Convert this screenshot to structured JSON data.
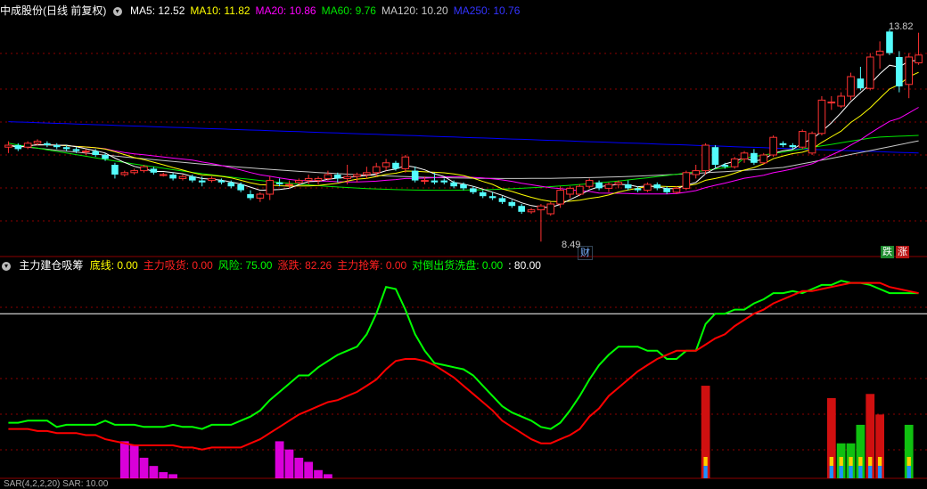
{
  "colors": {
    "up": "#ff3232",
    "down": "#54fcfc",
    "ma5": "#ffffff",
    "ma10": "#ffff00",
    "ma20": "#ff00ff",
    "ma60": "#00e600",
    "ma120": "#c8c8c8",
    "ma250": "#0000ff",
    "grid": "#8b0000",
    "risk": "#00ff00",
    "zhangdie": "#ff0000",
    "pink": "#ff00ff",
    "white_line": "#ffffff"
  },
  "price_panel": {
    "stock_title": "中成股份(日线 前复权)",
    "ma_legend": [
      {
        "label": "MA5: 12.52",
        "color": "#ffffff"
      },
      {
        "label": "MA10: 11.82",
        "color": "#ffff00"
      },
      {
        "label": "MA20: 10.86",
        "color": "#ff00ff"
      },
      {
        "label": "MA60: 9.76",
        "color": "#00e600"
      },
      {
        "label": "MA120: 10.20",
        "color": "#c8c8c8"
      },
      {
        "label": "MA250: 10.76",
        "color": "#3333ff"
      }
    ],
    "high_label": "13.82",
    "low_label": "8.49",
    "badge_cai": "财",
    "badge_die": "跌",
    "badge_zhang": "涨"
  },
  "indicator_panel": {
    "title": "主力建仓吸筹",
    "items": [
      {
        "label": "底线: 0.00",
        "color": "#ffff00"
      },
      {
        "label": "主力吸货: 0.00",
        "color": "#ff2020"
      },
      {
        "label": "风险: 75.00",
        "color": "#00ff00"
      },
      {
        "label": "涨跌: 82.26",
        "color": "#ff2020"
      },
      {
        "label": "主力抢筹: 0.00",
        "color": "#ff2020"
      },
      {
        "label": "对倒出货洗盘: 0.00",
        "color": "#00ff00"
      },
      {
        "label": ": 80.00",
        "color": "#ffffff"
      }
    ]
  },
  "bottom_panel": {
    "label": "SAR(4,2,2,20)  SAR: 10.00"
  },
  "chart_data": [
    {
      "type": "candlestick",
      "title": "中成股份(日线 前复权)",
      "ylim": [
        8.2,
        14.2
      ],
      "candles": [
        [
          10.9,
          11.05,
          10.75,
          10.95
        ],
        [
          10.95,
          11.0,
          10.8,
          10.85
        ],
        [
          10.9,
          11.05,
          10.85,
          11.0
        ],
        [
          11.0,
          11.1,
          10.95,
          11.05
        ],
        [
          11.0,
          11.05,
          10.9,
          10.95
        ],
        [
          10.95,
          11.0,
          10.85,
          10.9
        ],
        [
          10.9,
          10.95,
          10.8,
          10.85
        ],
        [
          10.85,
          10.9,
          10.75,
          10.8
        ],
        [
          10.8,
          10.85,
          10.7,
          10.8
        ],
        [
          10.8,
          10.85,
          10.65,
          10.7
        ],
        [
          10.7,
          10.75,
          10.55,
          10.6
        ],
        [
          10.45,
          10.5,
          10.1,
          10.2
        ],
        [
          10.2,
          10.3,
          10.15,
          10.25
        ],
        [
          10.25,
          10.35,
          10.2,
          10.3
        ],
        [
          10.3,
          10.45,
          10.25,
          10.4
        ],
        [
          10.35,
          10.4,
          10.2,
          10.25
        ],
        [
          10.2,
          10.25,
          10.15,
          10.2
        ],
        [
          10.2,
          10.25,
          10.05,
          10.1
        ],
        [
          10.1,
          10.2,
          10.05,
          10.15
        ],
        [
          10.15,
          10.2,
          10.0,
          10.05
        ],
        [
          10.05,
          10.15,
          9.9,
          10.0
        ],
        [
          10.05,
          10.15,
          10.0,
          10.1
        ],
        [
          10.05,
          10.1,
          9.95,
          10.0
        ],
        [
          10.0,
          10.05,
          9.85,
          9.9
        ],
        [
          9.95,
          10.0,
          9.75,
          9.8
        ],
        [
          9.7,
          9.8,
          9.55,
          9.6
        ],
        [
          9.6,
          9.75,
          9.5,
          9.7
        ],
        [
          9.7,
          10.15,
          9.55,
          10.05
        ],
        [
          10.0,
          10.1,
          9.9,
          9.95
        ],
        [
          9.95,
          10.05,
          9.85,
          9.95
        ],
        [
          10.0,
          10.1,
          9.95,
          10.05
        ],
        [
          10.05,
          10.2,
          9.95,
          10.1
        ],
        [
          10.05,
          10.15,
          9.95,
          10.1
        ],
        [
          10.1,
          10.3,
          10.05,
          10.2
        ],
        [
          10.2,
          10.25,
          10.0,
          10.1
        ],
        [
          10.1,
          10.45,
          9.95,
          10.15
        ],
        [
          10.15,
          10.25,
          10.0,
          10.2
        ],
        [
          10.2,
          10.4,
          10.1,
          10.25
        ],
        [
          10.25,
          10.5,
          10.15,
          10.4
        ],
        [
          10.4,
          10.6,
          10.3,
          10.5
        ],
        [
          10.5,
          10.55,
          10.3,
          10.35
        ],
        [
          10.35,
          10.7,
          10.25,
          10.65
        ],
        [
          10.3,
          10.4,
          10.0,
          10.05
        ],
        [
          10.05,
          10.15,
          9.95,
          10.05
        ],
        [
          10.05,
          10.25,
          9.95,
          10.0
        ],
        [
          10.05,
          10.1,
          9.95,
          10.0
        ],
        [
          10.0,
          10.05,
          9.85,
          9.9
        ],
        [
          9.95,
          10.0,
          9.8,
          9.85
        ],
        [
          9.85,
          9.9,
          9.7,
          9.75
        ],
        [
          9.75,
          9.8,
          9.6,
          9.65
        ],
        [
          9.65,
          9.75,
          9.55,
          9.6
        ],
        [
          9.6,
          9.65,
          9.45,
          9.5
        ],
        [
          9.5,
          9.55,
          9.35,
          9.4
        ],
        [
          9.4,
          9.45,
          9.2,
          9.25
        ],
        [
          9.25,
          9.35,
          9.2,
          9.3
        ],
        [
          9.3,
          9.45,
          8.49,
          9.4
        ],
        [
          9.2,
          9.5,
          9.15,
          9.45
        ],
        [
          9.45,
          9.9,
          9.35,
          9.8
        ],
        [
          9.7,
          9.9,
          9.6,
          9.85
        ],
        [
          9.7,
          9.95,
          9.65,
          9.9
        ],
        [
          9.9,
          10.1,
          9.85,
          10.05
        ],
        [
          10.0,
          10.05,
          9.8,
          9.85
        ],
        [
          9.85,
          10.0,
          9.75,
          9.95
        ],
        [
          9.95,
          10.05,
          9.85,
          10.0
        ],
        [
          9.95,
          10.05,
          9.8,
          9.85
        ],
        [
          9.85,
          9.9,
          9.75,
          9.8
        ],
        [
          9.8,
          10.0,
          9.75,
          9.95
        ],
        [
          9.95,
          10.0,
          9.8,
          9.85
        ],
        [
          9.85,
          9.9,
          9.7,
          9.75
        ],
        [
          9.75,
          9.9,
          9.7,
          9.85
        ],
        [
          9.85,
          10.3,
          9.8,
          10.25
        ],
        [
          10.2,
          10.45,
          10.1,
          10.3
        ],
        [
          10.3,
          11.0,
          10.2,
          10.95
        ],
        [
          10.9,
          10.95,
          10.35,
          10.45
        ],
        [
          10.45,
          10.5,
          10.35,
          10.4
        ],
        [
          10.4,
          10.65,
          10.35,
          10.6
        ],
        [
          10.6,
          10.8,
          10.5,
          10.75
        ],
        [
          10.75,
          10.85,
          10.45,
          10.5
        ],
        [
          10.5,
          10.75,
          10.45,
          10.7
        ],
        [
          10.7,
          11.2,
          10.65,
          11.15
        ],
        [
          11.0,
          11.05,
          10.9,
          10.95
        ],
        [
          10.95,
          11.0,
          10.85,
          10.9
        ],
        [
          10.9,
          11.35,
          10.85,
          11.3
        ],
        [
          10.75,
          11.3,
          10.7,
          11.25
        ],
        [
          11.25,
          12.2,
          11.2,
          12.1
        ],
        [
          12.05,
          12.2,
          11.85,
          12.05
        ],
        [
          11.95,
          12.3,
          11.9,
          12.2
        ],
        [
          12.2,
          12.8,
          12.1,
          12.7
        ],
        [
          12.65,
          12.95,
          12.35,
          12.4
        ],
        [
          12.4,
          13.3,
          12.35,
          13.2
        ],
        [
          13.25,
          13.6,
          12.9,
          13.35
        ],
        [
          13.85,
          13.9,
          13.25,
          13.3
        ],
        [
          13.2,
          13.35,
          12.3,
          12.45
        ],
        [
          12.5,
          13.3,
          12.15,
          13.2
        ],
        [
          13.05,
          13.82,
          13.0,
          13.25
        ]
      ]
    },
    {
      "type": "line",
      "title": "主力建仓吸筹",
      "ylim": [
        0,
        100
      ],
      "series": [
        {
          "name": "风险",
          "values": [
            27,
            27,
            28,
            28,
            28,
            25,
            26,
            26,
            26,
            26,
            28,
            26,
            26,
            26,
            25,
            25,
            25,
            26,
            25,
            25,
            24,
            26,
            26,
            26,
            28,
            30,
            33,
            38,
            42,
            46,
            50,
            50,
            54,
            57,
            60,
            62,
            64,
            70,
            80,
            93,
            92,
            82,
            70,
            62,
            56,
            55,
            54,
            53,
            50,
            45,
            40,
            35,
            32,
            30,
            28,
            25,
            24,
            27,
            33,
            40,
            48,
            55,
            60,
            64,
            64,
            64,
            62,
            62,
            58,
            58,
            62,
            62,
            75,
            80,
            80,
            82,
            82,
            85,
            87,
            90,
            90,
            91,
            90,
            92,
            94,
            94,
            96,
            95,
            95,
            94,
            92,
            90,
            90,
            90,
            90
          ]
        },
        {
          "name": "涨跌",
          "values": [
            24,
            24,
            24,
            23,
            23,
            22,
            22,
            22,
            21,
            21,
            19,
            18,
            17,
            16,
            16,
            16,
            16,
            16,
            15,
            15,
            14,
            15,
            15,
            15,
            15,
            17,
            19,
            22,
            25,
            28,
            31,
            33,
            35,
            37,
            38,
            40,
            42,
            45,
            48,
            53,
            57,
            58,
            58,
            57,
            55,
            52,
            49,
            45,
            41,
            37,
            33,
            28,
            25,
            22,
            19,
            17,
            17,
            19,
            21,
            24,
            30,
            34,
            40,
            44,
            48,
            52,
            55,
            58,
            60,
            62,
            62,
            62,
            65,
            68,
            70,
            74,
            77,
            80,
            82,
            85,
            87,
            89,
            91,
            91,
            92,
            93,
            94,
            95,
            95,
            95,
            95,
            93,
            92,
            91,
            90
          ]
        },
        {
          "name": "主力吸货",
          "bars": [
            0,
            0,
            0,
            0,
            0,
            0,
            0,
            0,
            0,
            0,
            0,
            0,
            18,
            16,
            10,
            6,
            3,
            2,
            0,
            0,
            0,
            0,
            0,
            0,
            0,
            0,
            0,
            0,
            18,
            14,
            10,
            8,
            4,
            2,
            0,
            0,
            0,
            0,
            0,
            0,
            0,
            0,
            0,
            0,
            0,
            0,
            0,
            0,
            0,
            0,
            0,
            0,
            0,
            0,
            0,
            0,
            0,
            0,
            0,
            0,
            0,
            0,
            0,
            0,
            0,
            0,
            0,
            0,
            0,
            0,
            0,
            0,
            0,
            0,
            0,
            0,
            0,
            0,
            0,
            0,
            0,
            0,
            0,
            0,
            0,
            0,
            0,
            0,
            0,
            0,
            0,
            0,
            0,
            0,
            0
          ]
        }
      ]
    }
  ]
}
